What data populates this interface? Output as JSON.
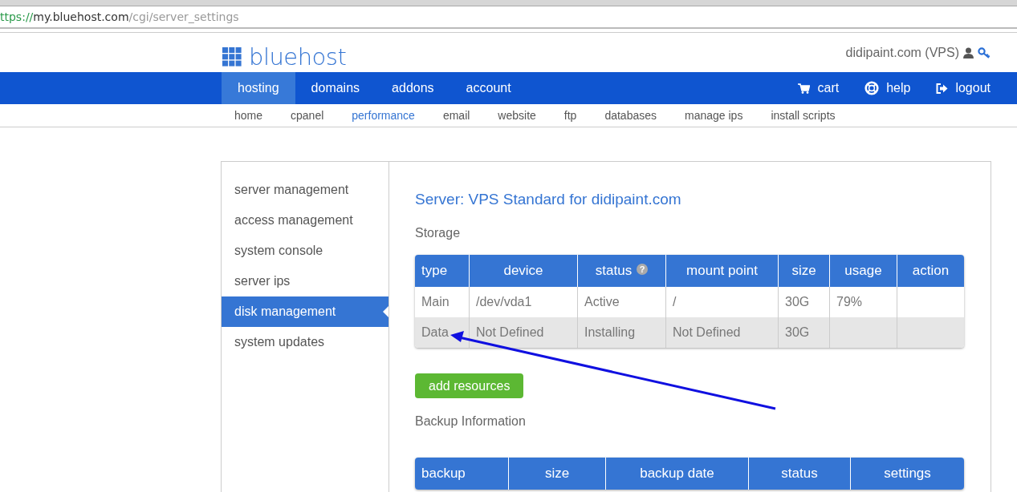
{
  "browser": {
    "url_scheme": "ttps://",
    "url_host": "my.bluehost.com",
    "url_path": "/cgi/server_settings"
  },
  "header": {
    "logo": "bluehost",
    "account": "didipaint.com (VPS)"
  },
  "nav": {
    "tabs": [
      {
        "label": "hosting",
        "selected": true
      },
      {
        "label": "domains",
        "selected": false
      },
      {
        "label": "addons",
        "selected": false
      },
      {
        "label": "account",
        "selected": false
      }
    ],
    "actions": [
      {
        "kind": "cart",
        "label": "cart"
      },
      {
        "kind": "help",
        "label": "help"
      },
      {
        "kind": "logout",
        "label": "logout"
      }
    ]
  },
  "subnav": [
    {
      "label": "home",
      "selected": false
    },
    {
      "label": "cpanel",
      "selected": false
    },
    {
      "label": "performance",
      "selected": true
    },
    {
      "label": "email",
      "selected": false
    },
    {
      "label": "website",
      "selected": false
    },
    {
      "label": "ftp",
      "selected": false
    },
    {
      "label": "databases",
      "selected": false
    },
    {
      "label": "manage ips",
      "selected": false
    },
    {
      "label": "install scripts",
      "selected": false
    }
  ],
  "sidebar": {
    "items": [
      {
        "label": "server management",
        "selected": false
      },
      {
        "label": "access management",
        "selected": false
      },
      {
        "label": "system console",
        "selected": false
      },
      {
        "label": "server ips",
        "selected": false
      },
      {
        "label": "disk management",
        "selected": true
      },
      {
        "label": "system updates",
        "selected": false
      }
    ]
  },
  "main": {
    "title": "Server: VPS Standard for didipaint.com",
    "storage_heading": "Storage",
    "storage_table": {
      "columns": [
        {
          "label": "type"
        },
        {
          "label": "device"
        },
        {
          "label": "status",
          "help_icon": "?"
        },
        {
          "label": "mount point"
        },
        {
          "label": "size"
        },
        {
          "label": "usage"
        },
        {
          "label": "action"
        }
      ],
      "rows": [
        [
          "Main",
          "/dev/vda1",
          "Active",
          "/",
          "30G",
          "79%",
          ""
        ],
        [
          "Data",
          "Not Defined",
          "Installing",
          "Not Defined",
          "30G",
          "",
          ""
        ]
      ]
    },
    "add_button": "add resources",
    "backup_heading": "Backup Information",
    "backup_table": {
      "columns": [
        "backup",
        "size",
        "backup date",
        "status",
        "settings"
      ]
    }
  }
}
